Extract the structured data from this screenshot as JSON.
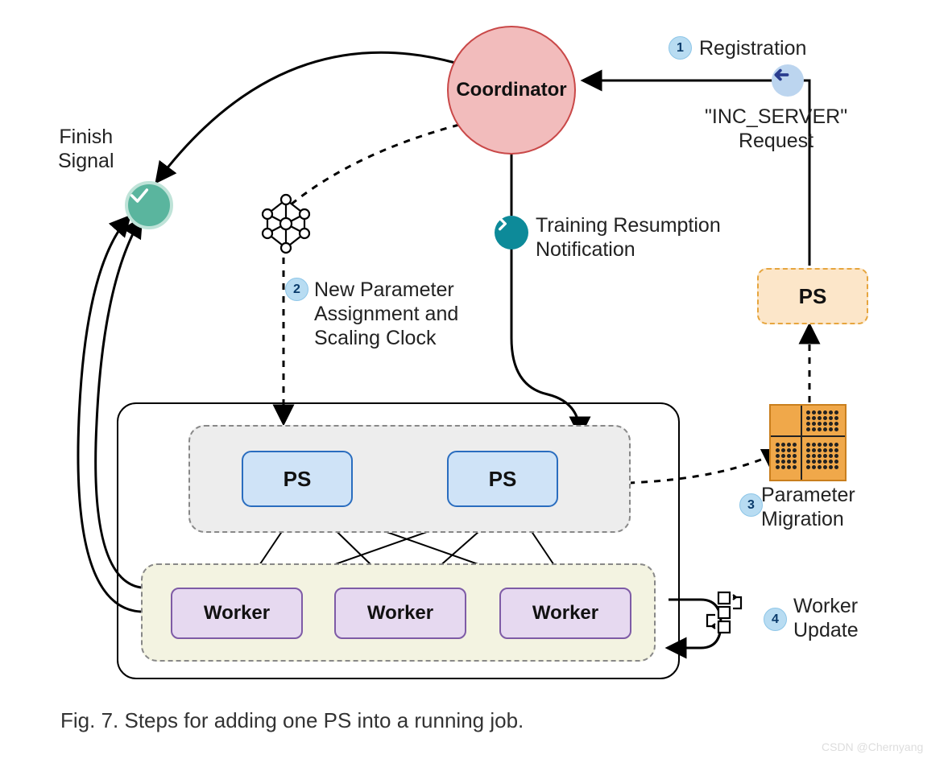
{
  "coordinator": {
    "label": "Coordinator"
  },
  "ps": {
    "label1": "PS",
    "label2": "PS",
    "new_label": "PS"
  },
  "workers": {
    "w1": "Worker",
    "w2": "Worker",
    "w3": "Worker"
  },
  "labels": {
    "finish_signal": "Finish\nSignal",
    "registration": "Registration",
    "inc_request": "\"INC_SERVER\"\nRequest",
    "training_resumption": "Training Resumption\nNotification",
    "new_param": "New Parameter\nAssignment and\nScaling Clock",
    "param_migration": "Parameter\nMigration",
    "worker_update": "Worker\nUpdate"
  },
  "badges": {
    "b1": "1",
    "b2": "2",
    "b3": "3",
    "b4": "4"
  },
  "caption": "Fig. 7. Steps for adding one PS into a running job.",
  "watermark": "CSDN @Chernyang"
}
